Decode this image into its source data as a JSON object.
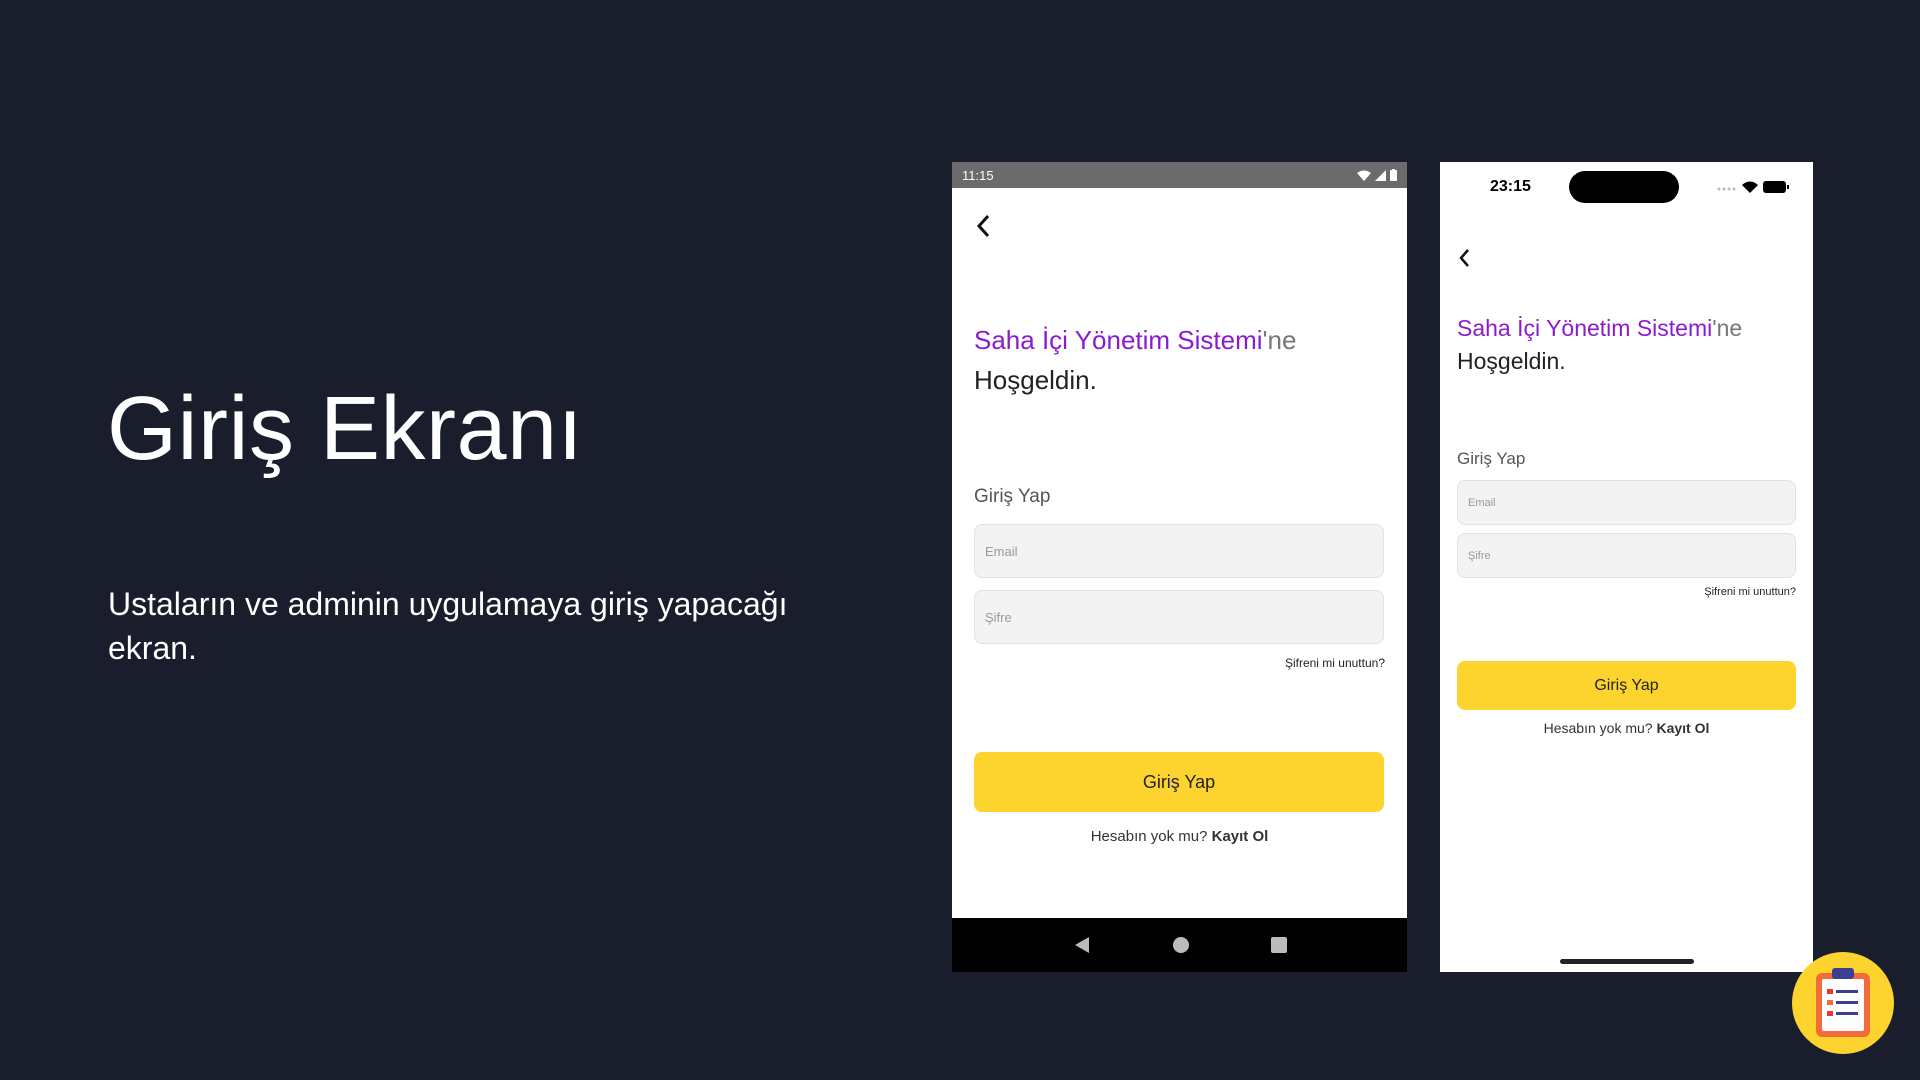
{
  "slide": {
    "title": "Giriş Ekranı",
    "description": "Ustaların ve adminin uygulamaya giriş yapacağı ekran."
  },
  "android": {
    "time": "11:15",
    "welcome_brand": "Saha İçi Yönetim Sistemi",
    "welcome_suffix": "'ne",
    "welcome_line2": "Hoşgeldin.",
    "section_label": "Giriş Yap",
    "email_placeholder": "Email",
    "password_placeholder": "Şifre",
    "forgot_label": "Şifreni mi unuttun?",
    "login_button": "Giriş Yap",
    "no_account": "Hesabın yok mu? ",
    "register_link": "Kayıt Ol"
  },
  "iphone": {
    "time": "23:15",
    "welcome_brand": "Saha İçi Yönetim Sistemi",
    "welcome_suffix": "'ne",
    "welcome_line2": "Hoşgeldin.",
    "section_label": "Giriş Yap",
    "email_placeholder": "Email",
    "password_placeholder": "Şifre",
    "forgot_label": "Şifreni mi unuttun?",
    "login_button": "Giriş Yap",
    "no_account": "Hesabın yok mu? ",
    "register_link": "Kayıt Ol"
  },
  "colors": {
    "background": "#1a1d2b",
    "brand_purple": "#8a1bd1",
    "button_yellow": "#fdd32e"
  },
  "icons": [
    "back-chevron-icon",
    "wifi-icon",
    "signal-icon",
    "battery-icon",
    "nav-back-icon",
    "nav-home-icon",
    "nav-recents-icon",
    "clipboard-icon"
  ]
}
